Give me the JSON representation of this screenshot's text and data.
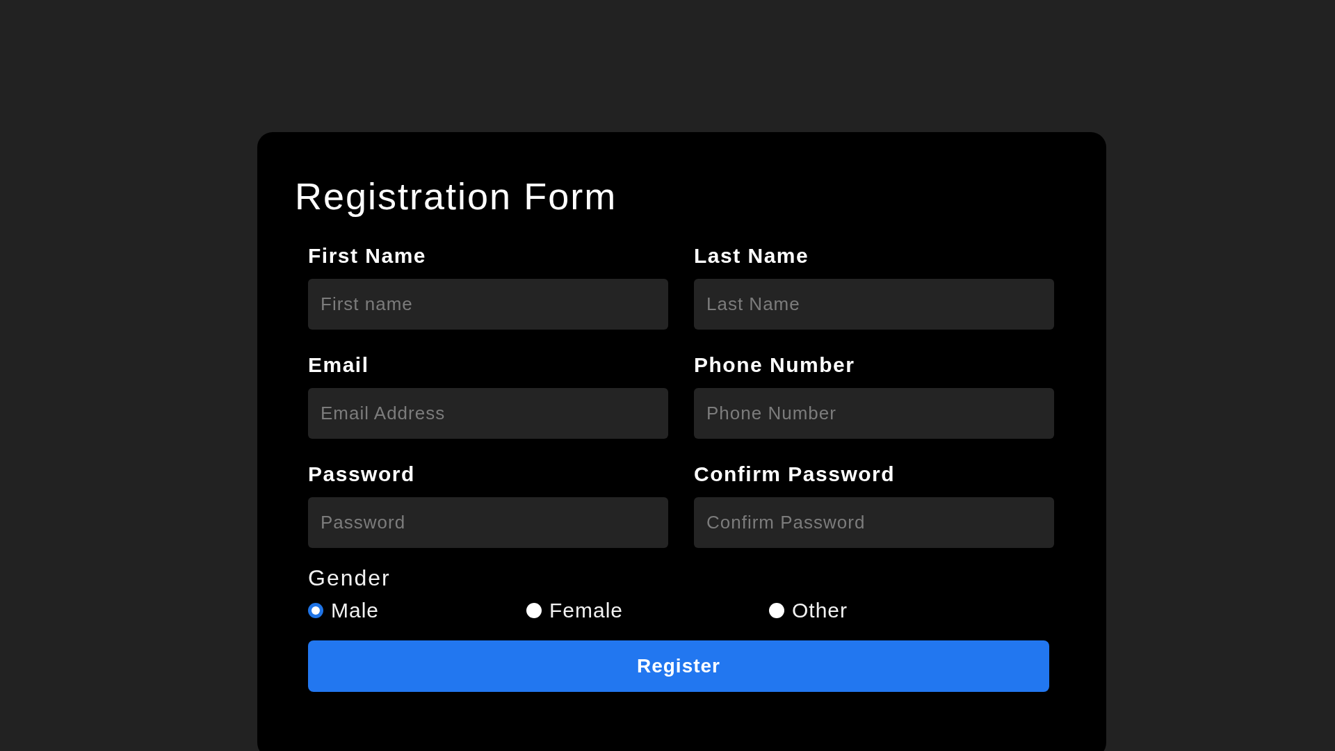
{
  "form": {
    "title": "Registration Form",
    "fields": [
      {
        "label": "First Name",
        "placeholder": "First name"
      },
      {
        "label": "Last Name",
        "placeholder": "Last Name"
      },
      {
        "label": "Email",
        "placeholder": "Email Address"
      },
      {
        "label": "Phone Number",
        "placeholder": "Phone Number"
      },
      {
        "label": "Password",
        "placeholder": "Password"
      },
      {
        "label": "Confirm Password",
        "placeholder": "Confirm Password"
      }
    ],
    "gender": {
      "label": "Gender",
      "options": [
        {
          "label": "Male",
          "selected": true
        },
        {
          "label": "Female",
          "selected": false
        },
        {
          "label": "Other",
          "selected": false
        }
      ]
    },
    "submit": "Register"
  }
}
